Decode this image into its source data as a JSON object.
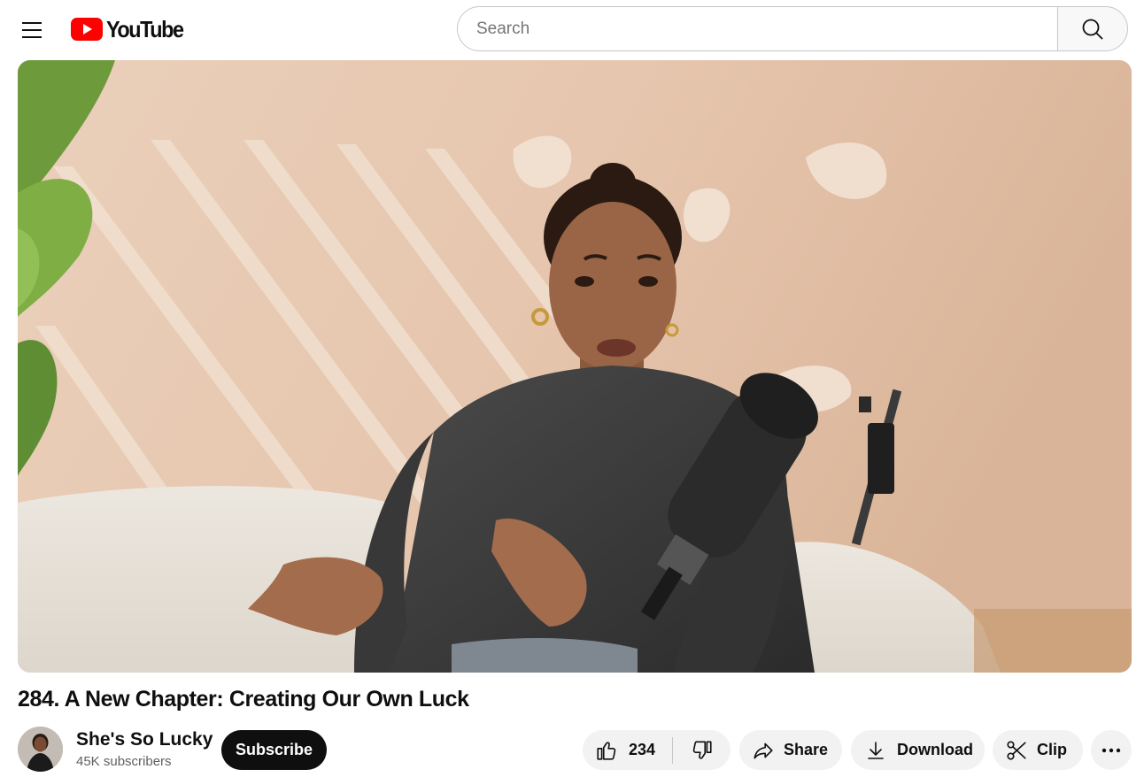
{
  "header": {
    "logo_text": "YouTube",
    "search_placeholder": "Search",
    "icons": {
      "menu": "hamburger-menu-icon",
      "logo": "youtube-play-icon",
      "search": "magnifier-icon"
    }
  },
  "video": {
    "title": "284. A New Chapter: Creating Our Own Luck"
  },
  "channel": {
    "name": "She's So Lucky",
    "subscribers": "45K subscribers",
    "subscribe_label": "Subscribe"
  },
  "actions": {
    "like_count": "234",
    "share_label": "Share",
    "download_label": "Download",
    "clip_label": "Clip",
    "icons": [
      "thumb-up-icon",
      "thumb-down-icon",
      "share-arrow-icon",
      "download-icon",
      "scissors-icon",
      "more-dots-icon"
    ]
  },
  "colors": {
    "brand_red": "#ff0000",
    "text_primary": "#0f0f0f",
    "text_secondary": "#606060",
    "pill_bg": "#f2f2f2",
    "subscribe_bg": "#0f0f0f"
  }
}
